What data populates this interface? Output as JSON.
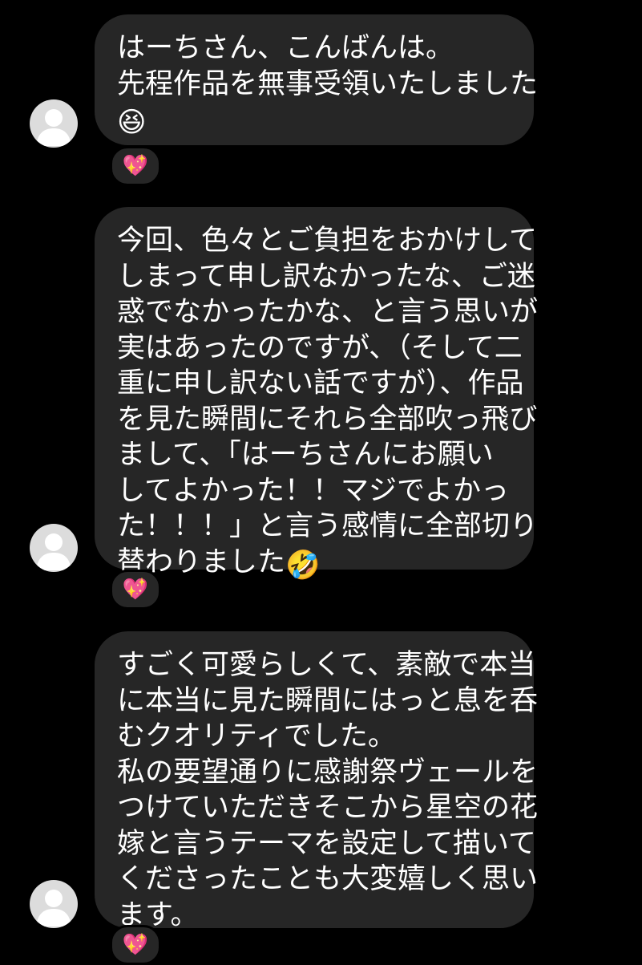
{
  "messages": [
    {
      "lines": [
        "はーちさん、こんばんは。",
        "先程作品を無事受領いたしました"
      ],
      "trailing_emoji": "😆",
      "reaction": "💖"
    },
    {
      "lines": [
        "今回、色々とご負担をおかけして",
        "しまって申し訳なかったな、ご迷",
        "惑でなかったかな、と言う思いが",
        "実はあったのですが、（そして二",
        "重に申し訳ない話ですが）、作品",
        "を見た瞬間にそれら全部吹っ飛び",
        "まして、「はーちさんにお願い",
        "してよかった！！マジでよかっ",
        "た！！！」と言う感情に全部切り",
        "替わりました"
      ],
      "trailing_emoji": "🤣",
      "reaction": "💖"
    },
    {
      "lines": [
        "すごく可愛らしくて、素敵で本当",
        "に本当に見た瞬間にはっと息を呑",
        "むクオリティでした。",
        "私の要望通りに感謝祭ヴェールを",
        "つけていただきそこから星空の花",
        "嫁と言うテーマを設定して描いて",
        "くださったことも大変嬉しく思い",
        "ます。"
      ],
      "trailing_emoji": "",
      "reaction": "💖"
    }
  ],
  "colors": {
    "background": "#000000",
    "bubble": "#262626",
    "text": "#ffffff",
    "avatar": "#dcdcdc"
  }
}
